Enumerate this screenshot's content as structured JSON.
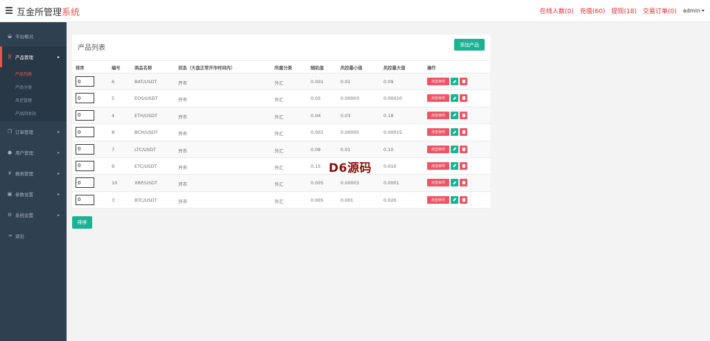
{
  "header": {
    "brand_main": "互金所管理",
    "brand_accent": "系统",
    "online": "在线人数(0)",
    "recharge": "充值(60)",
    "withdraw": "提现(18)",
    "orders": "交易订单(0)",
    "user": "admin"
  },
  "sidebar": {
    "items": [
      {
        "label": "平台概况",
        "icon": "dashboard-icon",
        "glyph": "◒"
      },
      {
        "label": "产品管理",
        "icon": "bitcoin-icon",
        "glyph": "₿"
      },
      {
        "label": "订单管理",
        "icon": "copy-icon",
        "glyph": "❐"
      },
      {
        "label": "用户管理",
        "icon": "user-icon",
        "glyph": "●"
      },
      {
        "label": "报表管理",
        "icon": "yen-icon",
        "glyph": "¥"
      },
      {
        "label": "参数设置",
        "icon": "archive-icon",
        "glyph": "▣"
      },
      {
        "label": "系统设置",
        "icon": "gears-icon",
        "glyph": "⚙"
      },
      {
        "label": "退出",
        "icon": "sign-out-icon",
        "glyph": "⇥"
      }
    ],
    "submenu": [
      "产品列表",
      "产品分类",
      "风控管理",
      "产品回收站"
    ]
  },
  "panel": {
    "title": "产品列表",
    "add_button": "添加产品",
    "columns": [
      "排序",
      "编号",
      "商品名称",
      "状态（大盘正常开市时间内）",
      "所属分类",
      "随机值",
      "风控最小值",
      "风控最大值",
      "操作"
    ],
    "rows": [
      {
        "sort": "0",
        "id": "6",
        "name": "BAT/USDT",
        "status": "开市",
        "category": "外汇",
        "random": "0.001",
        "min": "0.01",
        "max": "0.09"
      },
      {
        "sort": "0",
        "id": "5",
        "name": "EOS/USDT",
        "status": "开市",
        "category": "外汇",
        "random": "0.05",
        "min": "0.00003",
        "max": "0.00010"
      },
      {
        "sort": "0",
        "id": "4",
        "name": "ETH/USDT",
        "status": "开市",
        "category": "外汇",
        "random": "0.04",
        "min": "0.03",
        "max": "0.18"
      },
      {
        "sort": "0",
        "id": "8",
        "name": "BCH/USDT",
        "status": "开市",
        "category": "外汇",
        "random": "0.001",
        "min": "0.00005",
        "max": "0.00015"
      },
      {
        "sort": "0",
        "id": "7",
        "name": "LTC/USDT",
        "status": "开市",
        "category": "外汇",
        "random": "0.08",
        "min": "0.01",
        "max": "0.10"
      },
      {
        "sort": "0",
        "id": "9",
        "name": "ETC/USDT",
        "status": "开市",
        "category": "外汇",
        "random": "0.15",
        "min": "",
        "max": "0.010"
      },
      {
        "sort": "0",
        "id": "10",
        "name": "XRP/USDT",
        "status": "开市",
        "category": "外汇",
        "random": "0.005",
        "min": "0.00003",
        "max": "0.0001"
      },
      {
        "sort": "0",
        "id": "3",
        "name": "BTC/USDT",
        "status": "开市",
        "category": "外汇",
        "random": "0.005",
        "min": "0.001",
        "max": "0.020"
      }
    ],
    "op_close": "点击休市",
    "sort_button": "排序"
  },
  "watermark": "D6源码",
  "colors": {
    "accent": "#e8584e",
    "primary": "#1ab394",
    "danger": "#ed5565",
    "sidebar": "#2f4050"
  }
}
